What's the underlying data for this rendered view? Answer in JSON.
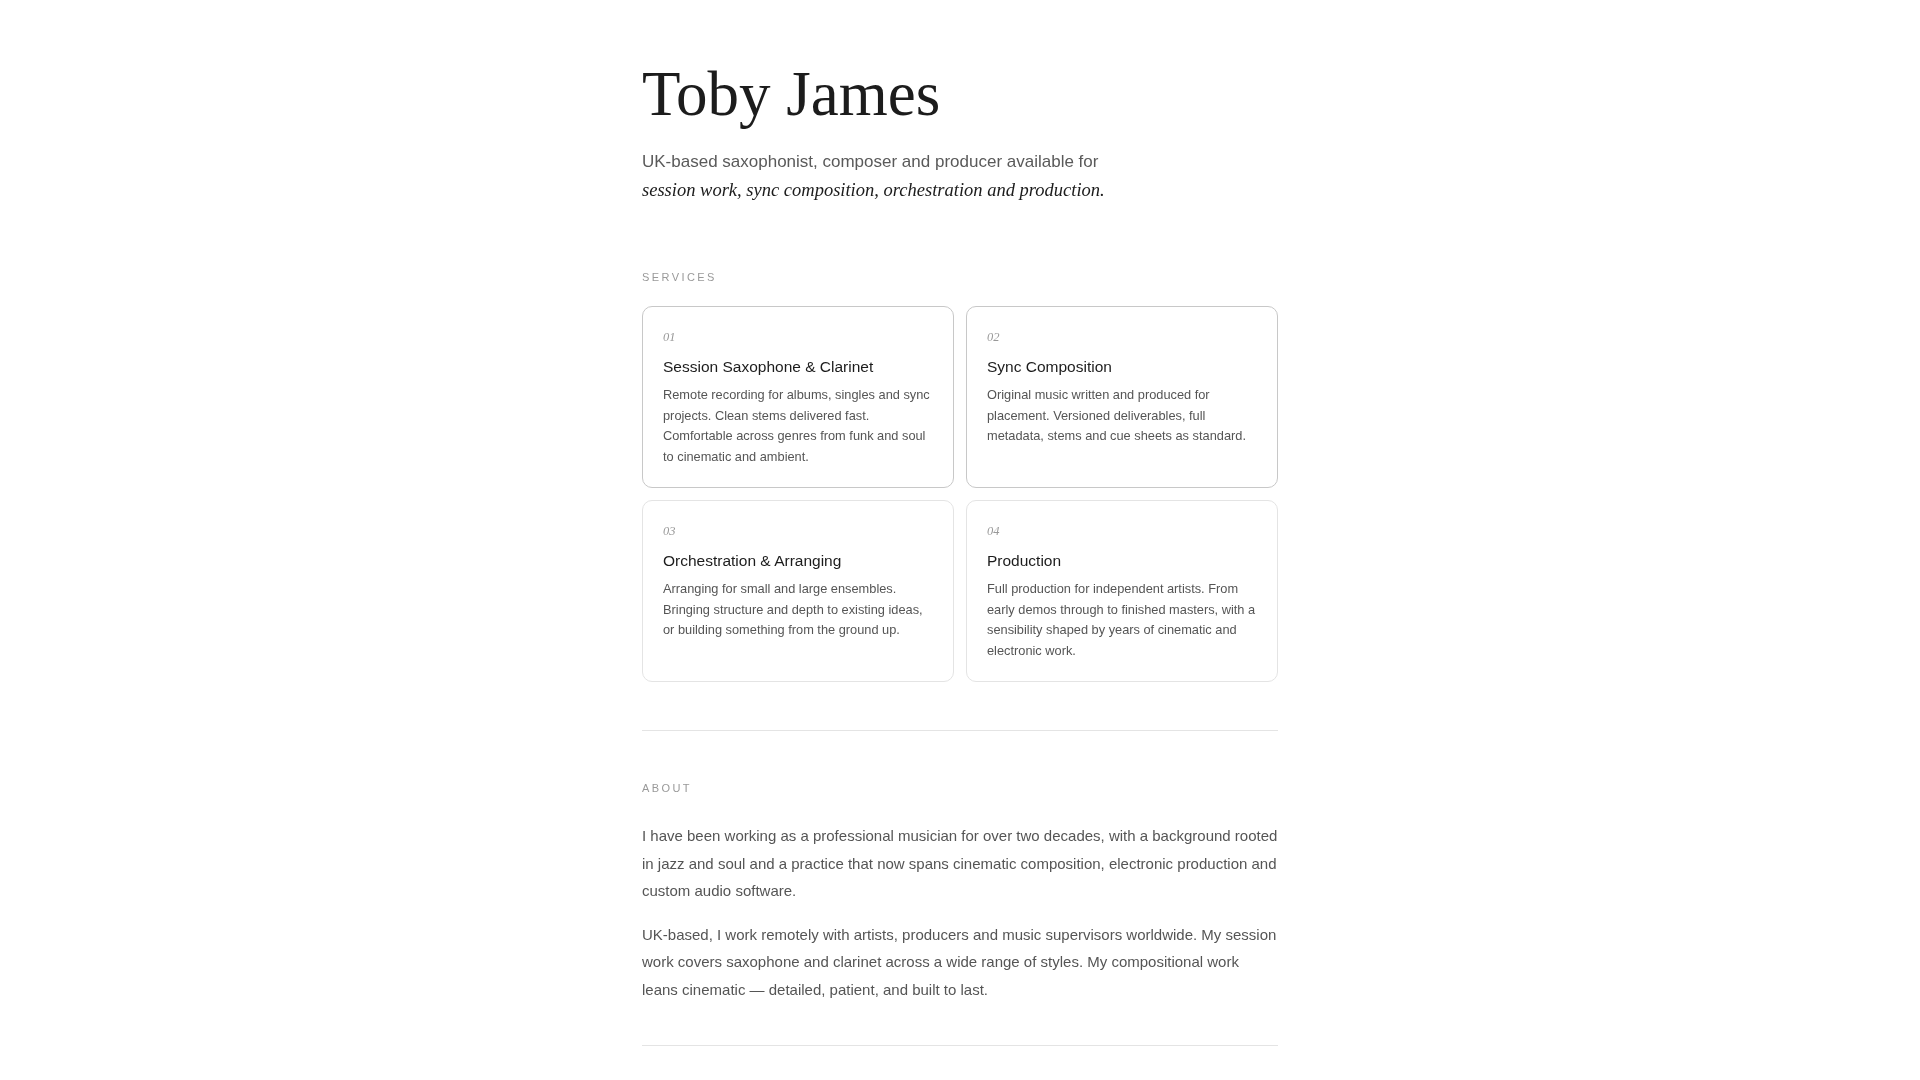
{
  "header": {
    "name": "Toby James",
    "intro": "UK-based saxophonist, composer and producer available for",
    "focus": "session work, sync composition, orchestration and production."
  },
  "services": {
    "label": "SERVICES",
    "cards": [
      {
        "number": "01",
        "title": "Session Saxophone & Clarinet",
        "description": "Remote recording for albums, singles and sync projects. Clean stems delivered fast. Comfortable across genres from funk and soul to cinematic and ambient.",
        "highlighted": true
      },
      {
        "number": "02",
        "title": "Sync Composition",
        "description": "Original music written and produced for placement. Versioned deliverables, full metadata, stems and cue sheets as standard.",
        "highlighted": true
      },
      {
        "number": "03",
        "title": "Orchestration & Arranging",
        "description": "Arranging for small and large ensembles. Bringing structure and depth to existing ideas, or building something from the ground up.",
        "highlighted": false
      },
      {
        "number": "04",
        "title": "Production",
        "description": "Full production for independent artists. From early demos through to finished masters, with a sensibility shaped by years of cinematic and electronic work.",
        "highlighted": false
      }
    ]
  },
  "about": {
    "label": "ABOUT",
    "paragraphs": [
      "I have been working as a professional musician for over two decades, with a background rooted in jazz and soul and a practice that now spans cinematic composition, electronic production and custom audio software.",
      "UK-based, I work remotely with artists, producers and music supervisors worldwide. My session work covers saxophone and clarinet across a wide range of styles. My compositional work leans cinematic — detailed, patient, and built to last."
    ]
  }
}
